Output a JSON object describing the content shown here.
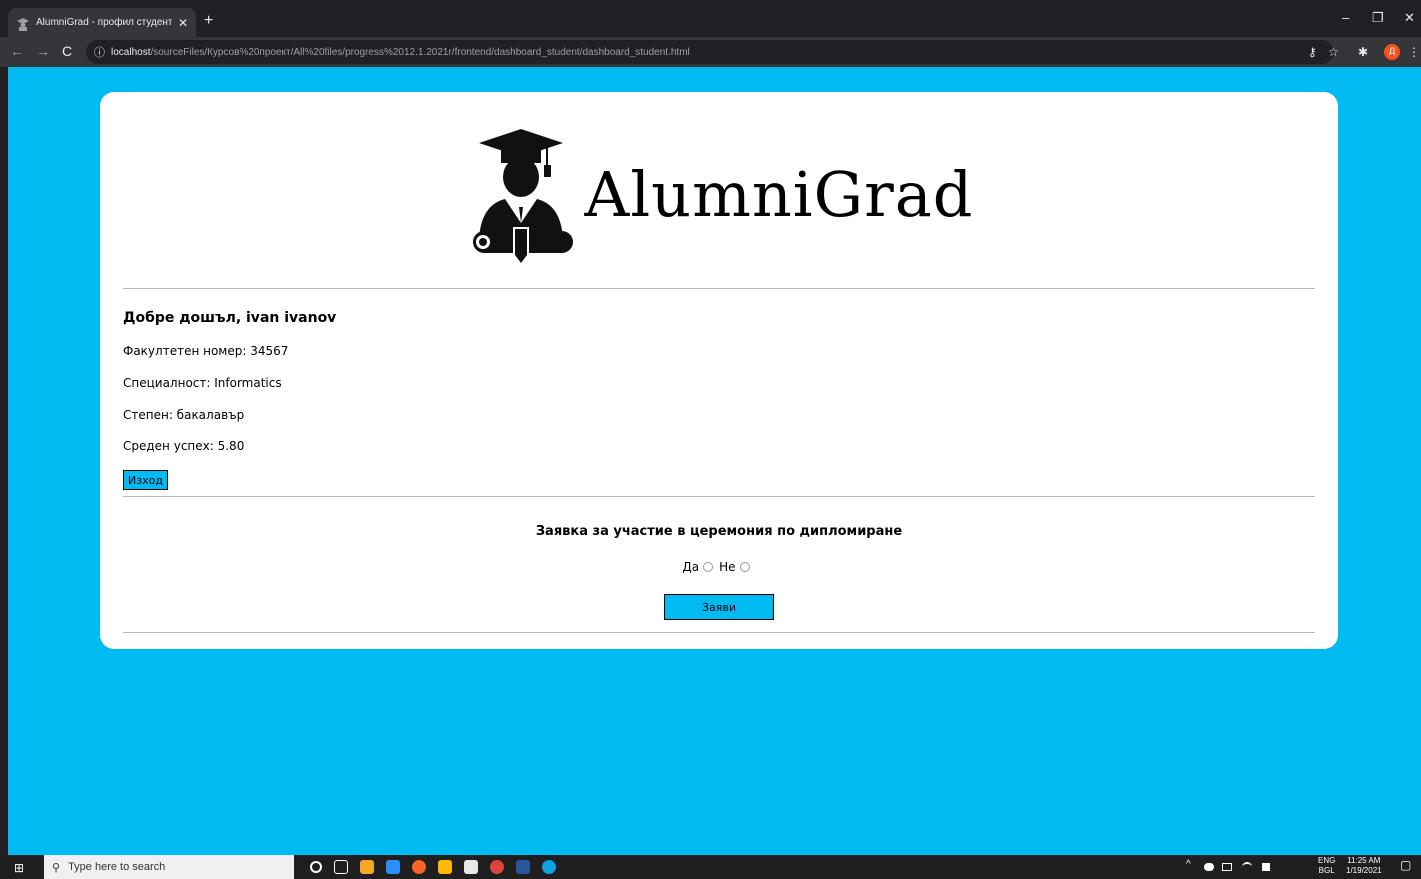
{
  "browser": {
    "tab_title": "AlumniGrad - профил студент",
    "tab_close": "✕",
    "new_tab": "+",
    "window_controls": {
      "minimize": "–",
      "restore": "❐",
      "close": "✕"
    },
    "back": "←",
    "forward": "→",
    "reload": "C",
    "info_icon": "ⓘ",
    "url_host": "localhost",
    "url_path": "/sourceFiles/Курсов%20проект/All%20files/progress%2012.1.2021r/frontend/dashboard_student/dashboard_student.html",
    "key_icon": "⚷",
    "star_icon": "☆",
    "ext_icon": "✱",
    "menu_icon": "⋮",
    "avatar_letter": "Д"
  },
  "page": {
    "logo_text": "AlumniGrad",
    "welcome": "Добре дошъл, ivan ivanov",
    "faculty_number": "Факултетен номер: 34567",
    "specialty": "Специалност: Informatics",
    "degree": "Степен: бакалавър",
    "average_grade": "Среден успех: 5.80",
    "logout_label": "Изход",
    "request_title": "Заявка за участие в церемония по дипломиране",
    "radio_yes": "Да",
    "radio_no": "Не",
    "submit_label": "Заяви"
  },
  "taskbar": {
    "start_icon": "⊞",
    "search_icon": "⚲",
    "search_placeholder": "Type here to search",
    "lang_top": "ENG",
    "lang_bottom": "BGL",
    "time": "11:25 AM",
    "date": "1/19/2021",
    "notification_icon": "▢"
  },
  "colors": {
    "page_background": "#00baf2",
    "button_fill": "#00baf2",
    "card": "#ffffff"
  }
}
